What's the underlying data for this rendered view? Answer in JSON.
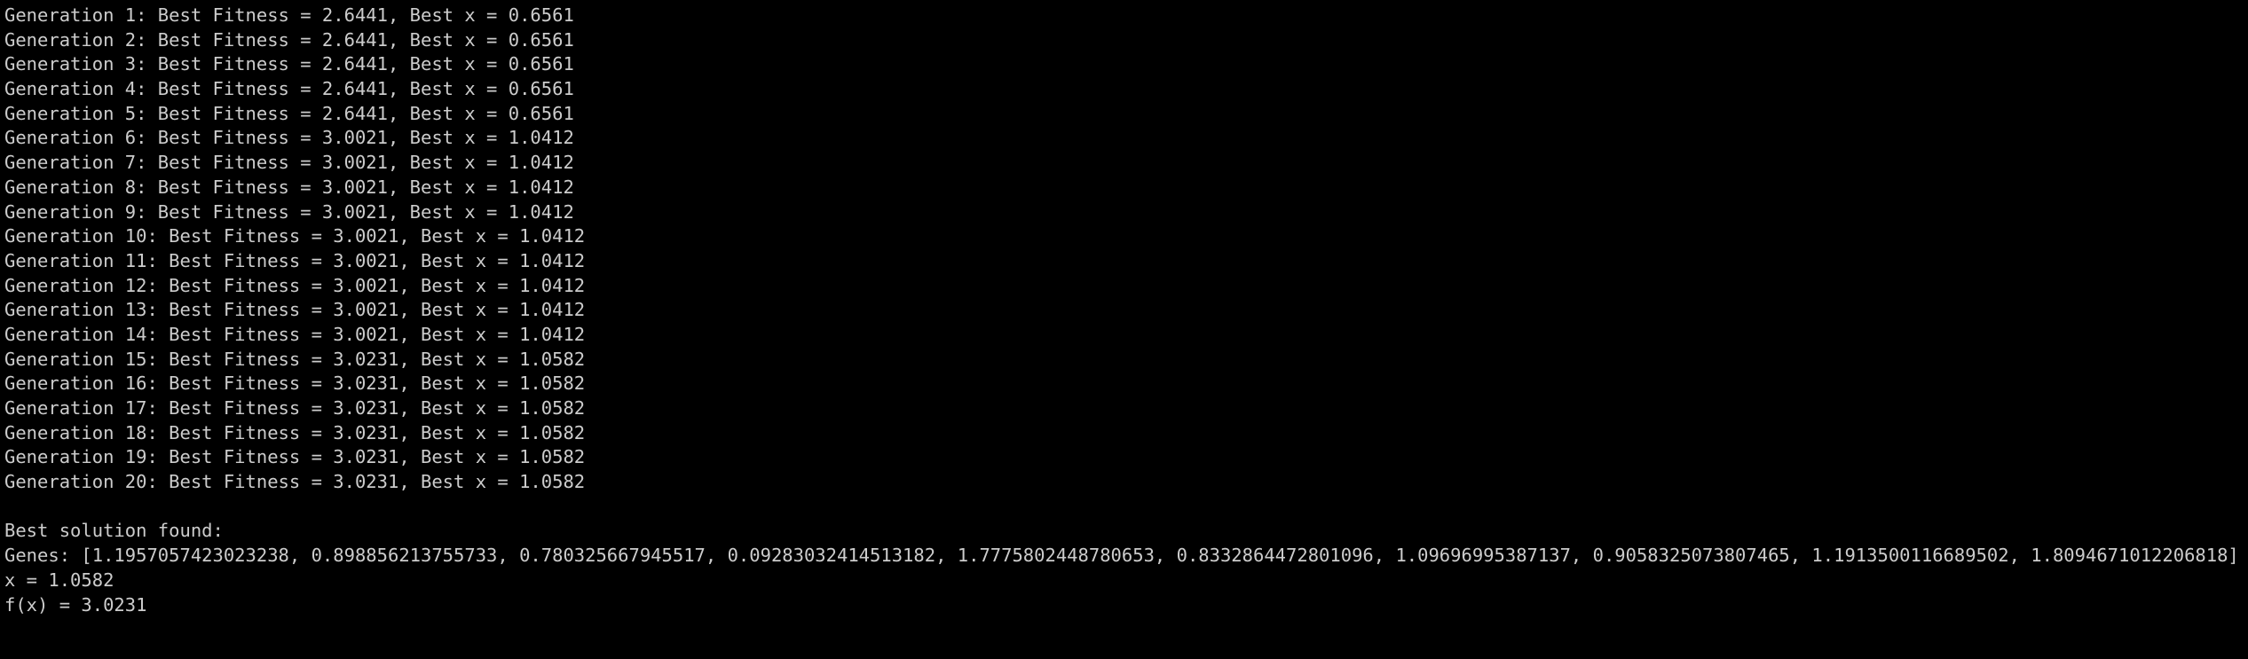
{
  "terminal": {
    "generations": [
      "Generation 1: Best Fitness = 2.6441, Best x = 0.6561",
      "Generation 2: Best Fitness = 2.6441, Best x = 0.6561",
      "Generation 3: Best Fitness = 2.6441, Best x = 0.6561",
      "Generation 4: Best Fitness = 2.6441, Best x = 0.6561",
      "Generation 5: Best Fitness = 2.6441, Best x = 0.6561",
      "Generation 6: Best Fitness = 3.0021, Best x = 1.0412",
      "Generation 7: Best Fitness = 3.0021, Best x = 1.0412",
      "Generation 8: Best Fitness = 3.0021, Best x = 1.0412",
      "Generation 9: Best Fitness = 3.0021, Best x = 1.0412",
      "Generation 10: Best Fitness = 3.0021, Best x = 1.0412",
      "Generation 11: Best Fitness = 3.0021, Best x = 1.0412",
      "Generation 12: Best Fitness = 3.0021, Best x = 1.0412",
      "Generation 13: Best Fitness = 3.0021, Best x = 1.0412",
      "Generation 14: Best Fitness = 3.0021, Best x = 1.0412",
      "Generation 15: Best Fitness = 3.0231, Best x = 1.0582",
      "Generation 16: Best Fitness = 3.0231, Best x = 1.0582",
      "Generation 17: Best Fitness = 3.0231, Best x = 1.0582",
      "Generation 18: Best Fitness = 3.0231, Best x = 1.0582",
      "Generation 19: Best Fitness = 3.0231, Best x = 1.0582",
      "Generation 20: Best Fitness = 3.0231, Best x = 1.0582"
    ],
    "summary": {
      "heading": "Best solution found:",
      "genes": "Genes: [1.1957057423023238, 0.898856213755733, 0.780325667945517, 0.09283032414513182, 1.7775802448780653, 0.8332864472801096, 1.09696995387137, 0.9058325073807465, 1.1913500116689502, 1.8094671012206818]",
      "x": "x = 1.0582",
      "fx": "f(x) = 3.0231"
    }
  }
}
